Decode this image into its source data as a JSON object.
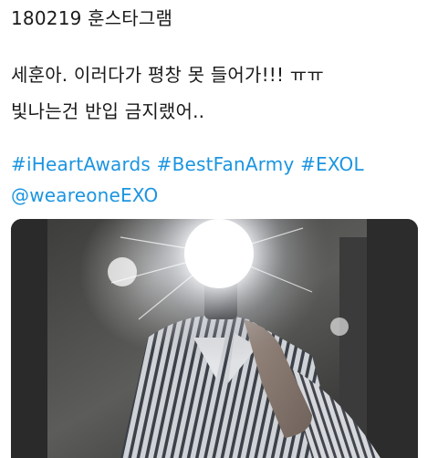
{
  "tweet": {
    "header_text": "180219 훈스타그램",
    "body_line1": "세훈아. 이러다가 평창 못 들어가!!! ㅠㅠ",
    "body_line2": "빛나는건 반입 금지랬어..",
    "hashtags": [
      "#iHeartAwards",
      "#BestFanArmy",
      "#EXOL"
    ],
    "mention": "@weareoneEXO",
    "colors": {
      "link": "#1b95e0",
      "text": "#1a1a1a"
    }
  },
  "media": {
    "icon": "photo-icon"
  }
}
